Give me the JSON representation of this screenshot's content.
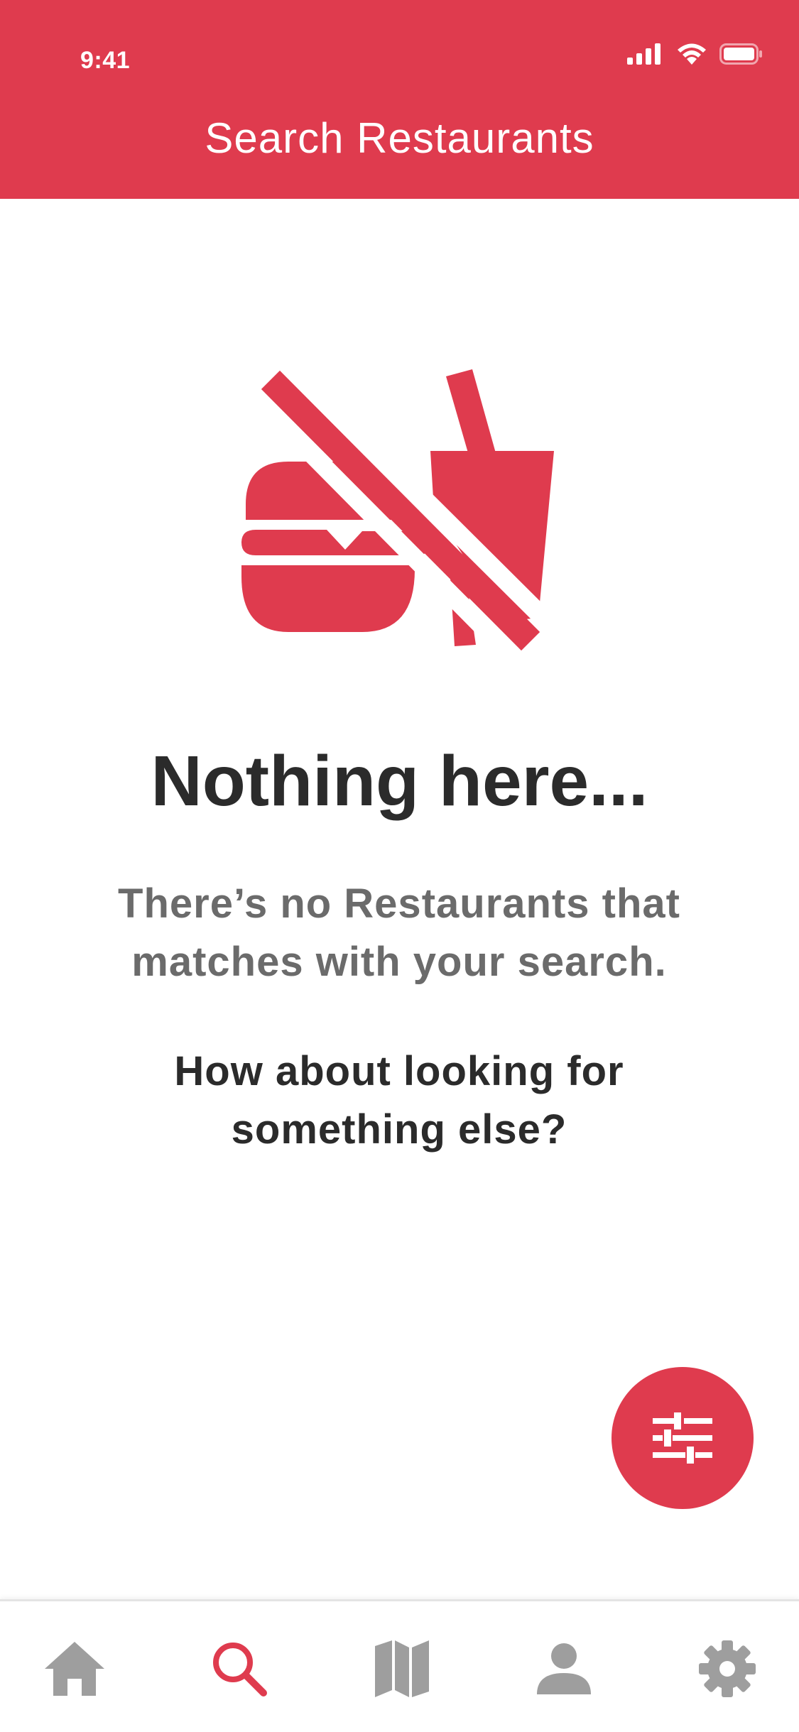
{
  "status_bar": {
    "time": "9:41"
  },
  "header": {
    "title": "Search Restaurants"
  },
  "empty_state": {
    "title": "Nothing here...",
    "message": "There’s no Restaurants that matches with your search.",
    "suggestion": "How about looking for something else?",
    "icon": "no-food-icon"
  },
  "fab": {
    "icon": "filter-sliders-icon"
  },
  "bottom_nav": {
    "items": [
      {
        "icon": "home-icon",
        "active": false
      },
      {
        "icon": "search-icon",
        "active": true
      },
      {
        "icon": "map-icon",
        "active": false
      },
      {
        "icon": "profile-icon",
        "active": false
      },
      {
        "icon": "settings-icon",
        "active": false
      }
    ]
  },
  "colors": {
    "brand": "#df3b4e",
    "title_text": "#2b2b2b",
    "body_text": "#6b6b6b",
    "nav_inactive": "#9e9e9e",
    "background": "#ffffff"
  }
}
